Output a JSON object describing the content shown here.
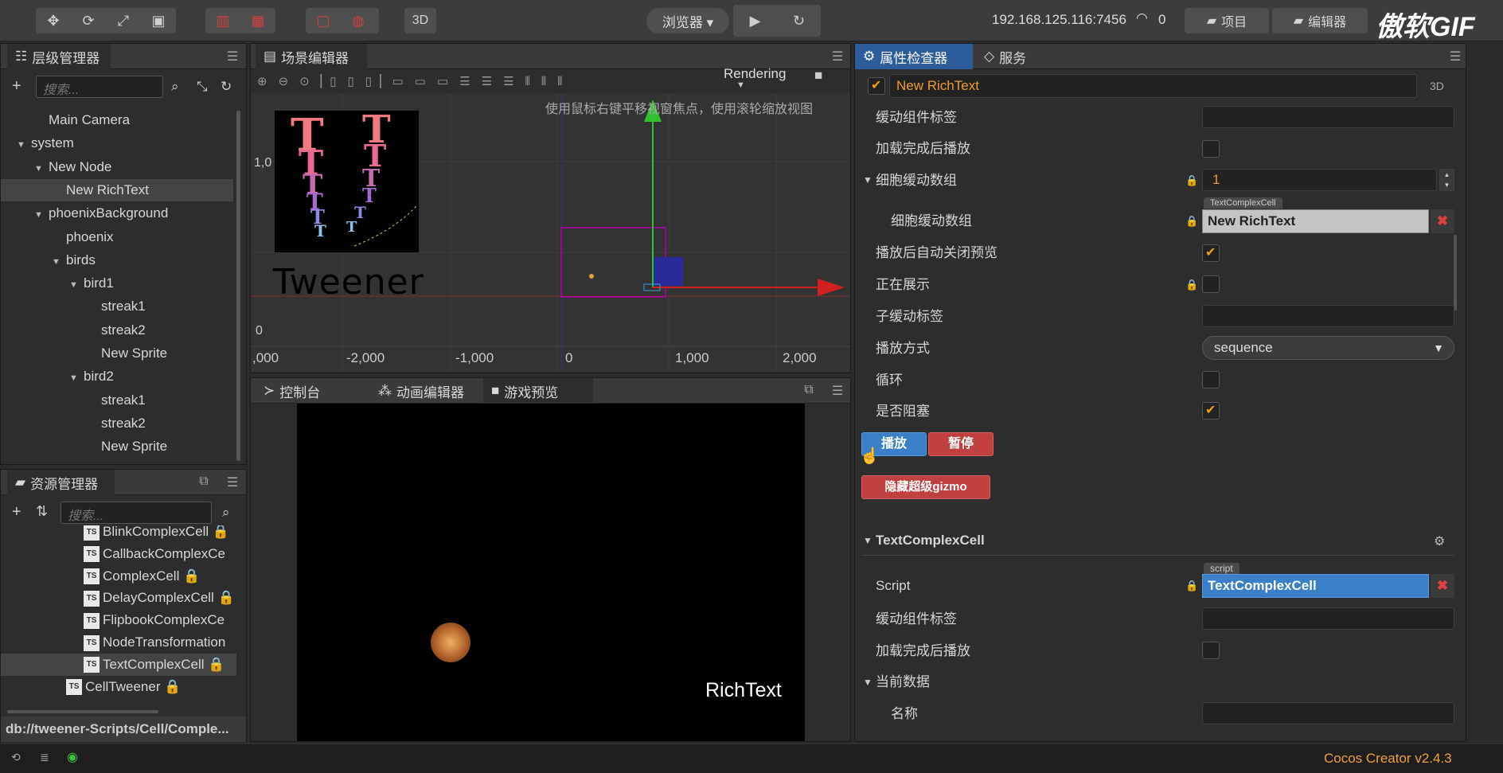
{
  "toolbar": {
    "transform_tools": [
      "move-icon",
      "rotate-icon",
      "scale-icon",
      "rect-icon"
    ],
    "mode_btn": "3D",
    "browser_label": "浏览器 ▾",
    "ip_address": "192.168.125.116:7456",
    "connected_count": "0",
    "project_btn": "项目",
    "editor_btn": "编辑器",
    "watermark": "傲软GIF"
  },
  "hierarchy": {
    "title": "层级管理器",
    "search_placeholder": "搜索...",
    "items": [
      {
        "label": "Main Camera",
        "depth": 2,
        "arrow": ""
      },
      {
        "label": "system",
        "depth": 1,
        "arrow": "▼"
      },
      {
        "label": "New Node",
        "depth": 2,
        "arrow": "▼"
      },
      {
        "label": "New RichText",
        "depth": 3,
        "arrow": "",
        "selected": true
      },
      {
        "label": "phoenixBackground",
        "depth": 2,
        "arrow": "▼"
      },
      {
        "label": "phoenix",
        "depth": 3,
        "arrow": ""
      },
      {
        "label": "birds",
        "depth": 3,
        "arrow": "▼"
      },
      {
        "label": "bird1",
        "depth": 4,
        "arrow": "▼"
      },
      {
        "label": "streak1",
        "depth": 5,
        "arrow": ""
      },
      {
        "label": "streak2",
        "depth": 5,
        "arrow": ""
      },
      {
        "label": "New Sprite",
        "depth": 5,
        "arrow": ""
      },
      {
        "label": "bird2",
        "depth": 4,
        "arrow": "▼"
      },
      {
        "label": "streak1",
        "depth": 5,
        "arrow": ""
      },
      {
        "label": "streak2",
        "depth": 5,
        "arrow": ""
      },
      {
        "label": "New Sprite",
        "depth": 5,
        "arrow": ""
      }
    ]
  },
  "assets": {
    "title": "资源管理器",
    "search_placeholder": "搜索...",
    "items": [
      {
        "label": "BlinkComplexCell 🔒"
      },
      {
        "label": "CallbackComplexCe"
      },
      {
        "label": "ComplexCell 🔒"
      },
      {
        "label": "DelayComplexCell 🔒"
      },
      {
        "label": "FlipbookComplexCe"
      },
      {
        "label": "NodeTransformation"
      },
      {
        "label": "TextComplexCell 🔒",
        "selected": true
      },
      {
        "label": "CellTweener 🔒",
        "outer": true
      }
    ],
    "path": "db://tweener-Scripts/Cell/Comple..."
  },
  "scene": {
    "title": "场景编辑器",
    "rendering_label": "Rendering",
    "hint": "使用鼠标右键平移视窗焦点，使用滚轮缩放视图",
    "ruler_x": [
      ",000",
      "-2,000",
      "-1,000",
      "0",
      "1,000",
      "2,000"
    ],
    "ruler_y": [
      "1,0",
      "0"
    ],
    "tweener_text": "Tweener"
  },
  "bottom_tabs": {
    "console": "控制台",
    "animation": "动画编辑器",
    "preview": "游戏预览"
  },
  "preview": {
    "richtext": "RichText"
  },
  "inspector": {
    "tab_props": "属性检查器",
    "tab_service": "服务",
    "node_name": "New RichText",
    "node_3d": "3D",
    "rows": {
      "tween_tag": "缓动组件标签",
      "play_on_load": "加载完成后播放",
      "cell_array": "细胞缓动数组",
      "cell_array_count": "1",
      "cell_array_item": "细胞缓动数组",
      "cell_type_tag": "TextComplexCell",
      "cell_value": "New RichText",
      "auto_close": "播放后自动关闭预览",
      "showing": "正在展示",
      "sub_tag": "子缓动标签",
      "play_mode": "播放方式",
      "play_mode_value": "sequence",
      "loop": "循环",
      "blocking": "是否阻塞"
    },
    "play_btn": "播放",
    "pause_btn": "暂停",
    "hide_gizmo_btn": "隐藏超级gizmo",
    "component": {
      "title": "TextComplexCell",
      "script_label": "Script",
      "script_tag": "script",
      "script_value": "TextComplexCell",
      "tween_tag": "缓动组件标签",
      "play_on_load": "加载完成后播放",
      "current_data": "当前数据",
      "name": "名称"
    }
  },
  "status": {
    "version": "Cocos Creator v2.4.3"
  }
}
